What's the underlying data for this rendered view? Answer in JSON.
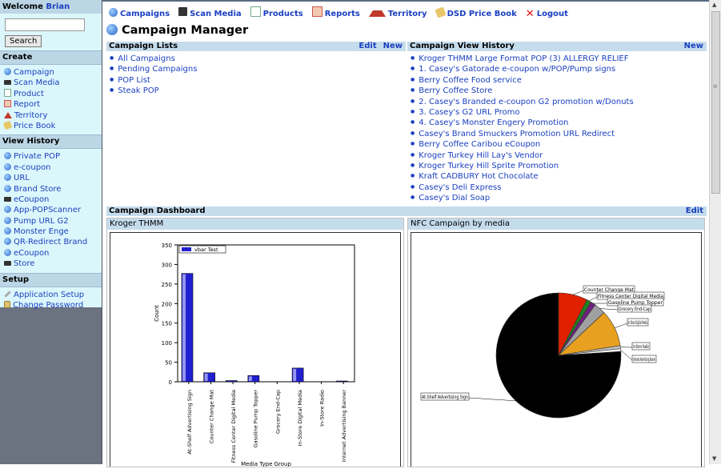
{
  "sidebar": {
    "welcome_label": "Welcome",
    "user_name": "Brian",
    "search_placeholder": "",
    "search_button": "Search",
    "sections": [
      {
        "title": "Create",
        "items": [
          {
            "label": "Campaign",
            "icon": "globe-icon"
          },
          {
            "label": "Scan Media",
            "icon": "scanner-icon"
          },
          {
            "label": "Product",
            "icon": "product-icon"
          },
          {
            "label": "Report",
            "icon": "report-icon"
          },
          {
            "label": "Territory",
            "icon": "territory-icon"
          },
          {
            "label": "Price Book",
            "icon": "tag-icon"
          }
        ]
      },
      {
        "title": "View History",
        "items": [
          {
            "label": "Private POP",
            "icon": "globe-icon"
          },
          {
            "label": "e-coupon",
            "icon": "globe-icon"
          },
          {
            "label": "URL",
            "icon": "globe-icon"
          },
          {
            "label": "Brand Store",
            "icon": "globe-icon"
          },
          {
            "label": "eCoupon",
            "icon": "scanner-icon"
          },
          {
            "label": "App-POPScanner",
            "icon": "globe-icon"
          },
          {
            "label": "Pump URL G2",
            "icon": "globe-icon"
          },
          {
            "label": "Monster Enge",
            "icon": "globe-icon"
          },
          {
            "label": "QR-Redirect Brand",
            "icon": "globe-icon"
          },
          {
            "label": "eCoupon",
            "icon": "globe-icon"
          },
          {
            "label": "Store",
            "icon": "scanner-icon"
          }
        ]
      },
      {
        "title": "Setup",
        "items": [
          {
            "label": "Application Setup",
            "icon": "wrench-icon"
          },
          {
            "label": "Change Password",
            "icon": "lock-icon"
          }
        ]
      }
    ]
  },
  "topnav": [
    {
      "label": "Campaigns",
      "icon": "globe-icon"
    },
    {
      "label": "Scan Media",
      "icon": "scanner-icon"
    },
    {
      "label": "Products",
      "icon": "product-icon"
    },
    {
      "label": "Reports",
      "icon": "report-icon"
    },
    {
      "label": "Territory",
      "icon": "territory-icon"
    },
    {
      "label": "DSD Price Book",
      "icon": "tag-icon"
    },
    {
      "label": "Logout",
      "icon": "close-icon"
    }
  ],
  "page_title": "Campaign Manager",
  "campaign_lists": {
    "title": "Campaign Lists",
    "edit": "Edit",
    "new": "New",
    "items": [
      "All Campaigns",
      "Pending Campaigns",
      "POP List",
      "Steak POP"
    ]
  },
  "campaign_history": {
    "title": "Campaign View History",
    "new": "New",
    "items": [
      "Kroger THMM Large Format POP (3) ALLERGY RELIEF",
      "1. Casey's Gatorade e-coupon w/POP/Pump signs",
      "Berry Coffee Food service",
      "Berry Coffee Store",
      "2. Casey's Branded e-coupon G2 promotion w/Donuts",
      "3. Casey's G2 URL Promo",
      "4. Casey's Monster Engery Promotion",
      "Casey's Brand Smuckers Promotion URL Redirect",
      "Berry Coffee Caribou eCoupon",
      "Kroger Turkey Hill Lay's Vendor",
      "Kroger Turkey Hill Sprite Promotion",
      "Kraft CADBURY Hot Chocolate",
      "Casey's Deli Express",
      "Casey's Dial Soap"
    ]
  },
  "dashboard": {
    "title": "Campaign Dashboard",
    "edit": "Edit"
  },
  "chart_data": [
    {
      "type": "bar",
      "panel_title": "Kroger THMM",
      "legend": "vbar Test",
      "ylabel": "Count",
      "xlabel": "Media Type Group",
      "ylim": [
        0,
        350
      ],
      "yticks": [
        0,
        50,
        100,
        150,
        200,
        250,
        300,
        350
      ],
      "categories": [
        "At-Shelf Advertising Sign",
        "Counter Change Mat",
        "Fitness Center Digital Media",
        "Gasoline Pump Topper",
        "Grocery End-Cap",
        "In-Store Digital Media",
        "In-Store Radio",
        "Internet Advertising Banner"
      ],
      "values": [
        277,
        23,
        3,
        16,
        0,
        35,
        0,
        2
      ],
      "color": "#2020d0"
    },
    {
      "type": "pie",
      "panel_title": "NFC Campaign by media",
      "labels": [
        "At-Shelf Advertising Sign",
        "Counter Change Mat",
        "Fitness Center Digital Media",
        "Gasoline Pump Topper",
        "Grocery End-Cap",
        "In-Store Digital Media",
        "In-Store Radio",
        "Internet Advertising Banner"
      ],
      "values": [
        76,
        7.5,
        1.2,
        1.3,
        3,
        9.5,
        0.8,
        0.7
      ],
      "colors": [
        "#000000",
        "#e02000",
        "#208020",
        "#702080",
        "#a0a0a0",
        "#e8a020",
        "#c0c0c0",
        "#ffffff"
      ]
    }
  ]
}
